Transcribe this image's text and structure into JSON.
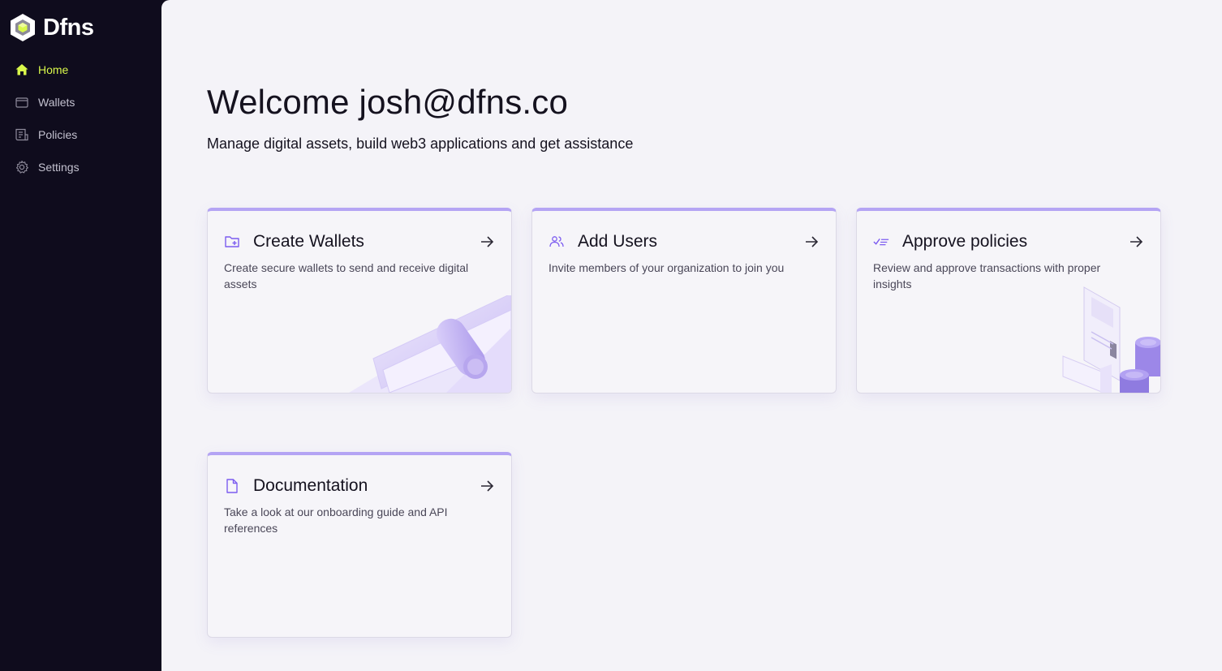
{
  "brand": {
    "name": "Dfns"
  },
  "sidebar": {
    "items": [
      {
        "label": "Home",
        "icon": "home-icon",
        "active": true
      },
      {
        "label": "Wallets",
        "icon": "wallet-icon",
        "active": false
      },
      {
        "label": "Policies",
        "icon": "policies-icon",
        "active": false
      },
      {
        "label": "Settings",
        "icon": "gear-icon",
        "active": false
      }
    ]
  },
  "main": {
    "title": "Welcome josh@dfns.co",
    "subtitle": "Manage digital assets, build web3 applications and get assistance",
    "cards": [
      {
        "title": "Create Wallets",
        "description": "Create secure wallets to send and receive digital assets",
        "icon": "folder-plus-icon"
      },
      {
        "title": "Add Users",
        "description": "Invite members of your organization to join you",
        "icon": "users-icon"
      },
      {
        "title": "Approve policies",
        "description": "Review and approve transactions with proper insights",
        "icon": "checklist-icon"
      },
      {
        "title": "Documentation",
        "description": "Take a look at our onboarding guide and API references",
        "icon": "document-icon"
      }
    ]
  },
  "colors": {
    "sidebar_bg": "#0f0c1d",
    "active_nav": "#d9f84a",
    "accent": "#b4a4f4",
    "icon_purple": "#7c5cf0"
  }
}
